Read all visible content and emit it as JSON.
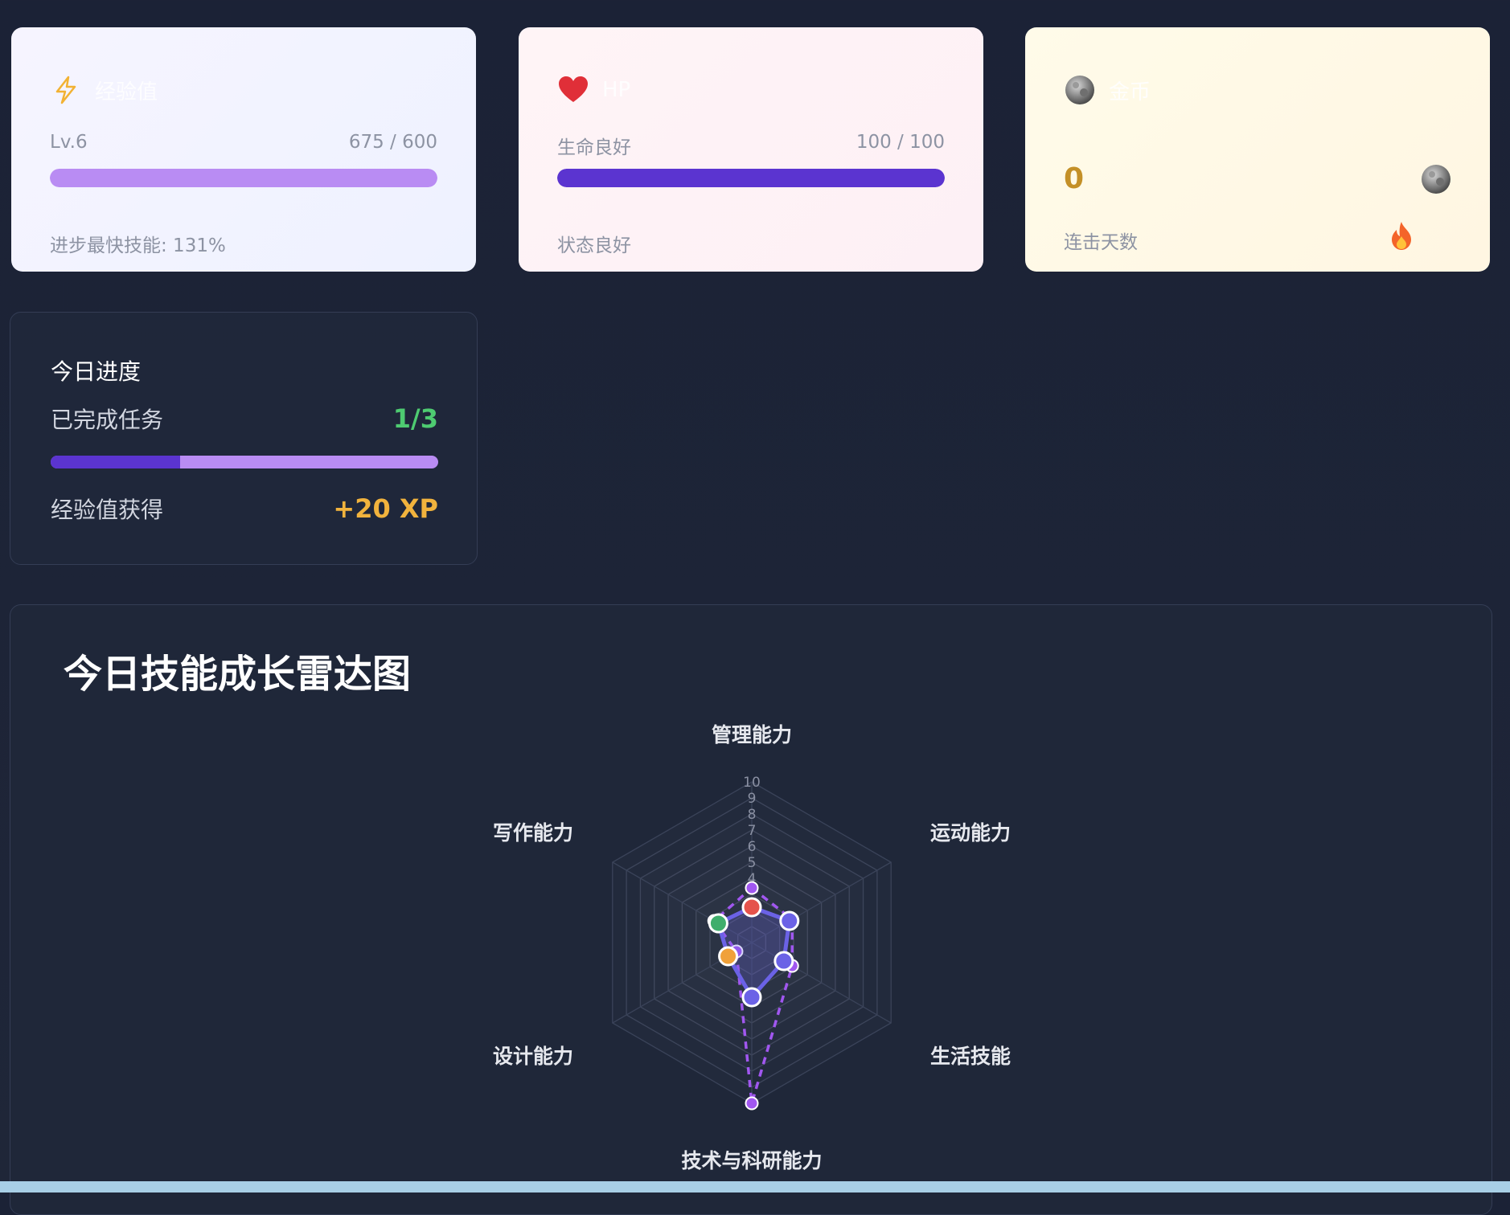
{
  "xp_card": {
    "title": "经验值",
    "level": "Lv.6",
    "xp": "675 / 600",
    "bar_fraction": 1.0,
    "subtitle": "进步最快技能: 131%",
    "bar_color": "#b98cf3"
  },
  "hp_card": {
    "title": "HP",
    "status": "生命良好",
    "hp": "100 / 100",
    "bar_fraction": 1.0,
    "subtitle": "状态良好",
    "bar_color": "#5b34d0"
  },
  "coin_card": {
    "title": "金币",
    "value": "0",
    "label": "连击天数"
  },
  "progress": {
    "title": "今日进度",
    "tasks_label": "已完成任务",
    "tasks_value": "1/3",
    "tasks_fraction": 0.333,
    "xp_label": "经验值获得",
    "xp_value": "+20 XP"
  },
  "radar": {
    "title": "今日技能成长雷达图",
    "tick_labels": [
      "4",
      "5",
      "6",
      "7",
      "8",
      "9",
      "10"
    ]
  },
  "chart_data": {
    "type": "radar",
    "title": "今日技能成长雷达图",
    "axes": [
      "管理能力",
      "运动能力",
      "生活技能",
      "技术与科研能力",
      "设计能力",
      "写作能力"
    ],
    "rlim": [
      0,
      10
    ],
    "tick_labels": [
      "4",
      "5",
      "6",
      "7",
      "8",
      "9",
      "10"
    ],
    "series": [
      {
        "values": [
          2.2,
          2.7,
          2.3,
          3.4,
          1.7,
          2.4
        ],
        "color": "#6b62e6",
        "style": "solid",
        "point_colors": [
          "#e5534b",
          "#6b62e6",
          "#6b62e6",
          "#6b62e6",
          "#f0a13a",
          "#3fae6c"
        ]
      },
      {
        "values": [
          3.4,
          2.9,
          2.9,
          10.0,
          1.1,
          2.7
        ],
        "color": "#a157f0",
        "style": "dashed"
      }
    ]
  }
}
